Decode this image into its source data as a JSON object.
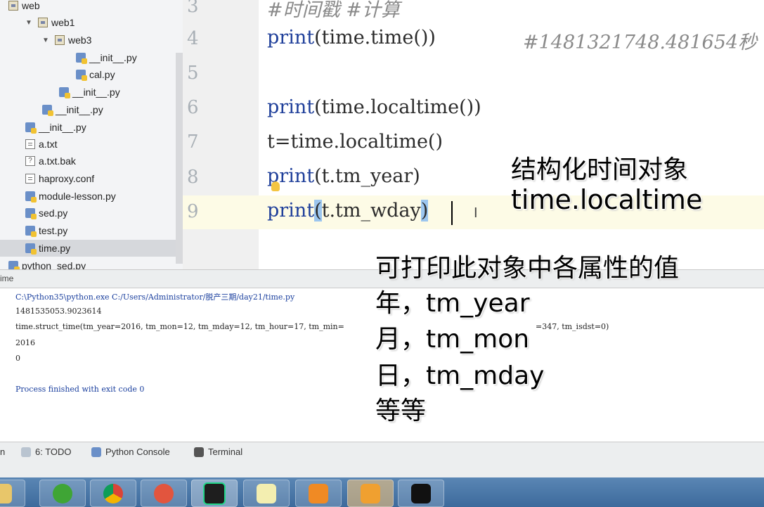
{
  "project_tree": [
    {
      "label": "web",
      "type": "folder",
      "indent": 0,
      "arrow": ""
    },
    {
      "label": "web1",
      "type": "folder",
      "indent": 1,
      "arrow": "▼"
    },
    {
      "label": "web3",
      "type": "folder",
      "indent": 2,
      "arrow": "▼"
    },
    {
      "label": "__init__.py",
      "type": "py",
      "indent": 4,
      "arrow": ""
    },
    {
      "label": "cal.py",
      "type": "py",
      "indent": 4,
      "arrow": ""
    },
    {
      "label": "__init__.py",
      "type": "py",
      "indent": 3,
      "arrow": ""
    },
    {
      "label": "__init__.py",
      "type": "py",
      "indent": 2,
      "arrow": ""
    },
    {
      "label": "__init__.py",
      "type": "py",
      "indent": 1,
      "arrow": ""
    },
    {
      "label": "a.txt",
      "type": "txt",
      "indent": 1,
      "arrow": ""
    },
    {
      "label": "a.txt.bak",
      "type": "unknown",
      "indent": 1,
      "arrow": ""
    },
    {
      "label": "haproxy.conf",
      "type": "txt",
      "indent": 1,
      "arrow": ""
    },
    {
      "label": "module-lesson.py",
      "type": "py",
      "indent": 1,
      "arrow": ""
    },
    {
      "label": "sed.py",
      "type": "py",
      "indent": 1,
      "arrow": ""
    },
    {
      "label": "test.py",
      "type": "py",
      "indent": 1,
      "arrow": ""
    },
    {
      "label": "time.py",
      "type": "py",
      "indent": 1,
      "arrow": "",
      "selected": true
    },
    {
      "label": "python_sed.py",
      "type": "py",
      "indent": 0,
      "arrow": ""
    }
  ],
  "editor": {
    "line_numbers": [
      "3",
      "4",
      "5",
      "6",
      "7",
      "8",
      "9"
    ],
    "line3_comment": "#时间戳    #计算",
    "line4_kw": "print",
    "line4_rest": "(time.time())",
    "line4_comment": "#1481321748.481654秒",
    "line6_kw": "print",
    "line6_rest": "(time.localtime())",
    "line7": "t=time.localtime()",
    "line8_kw": "print",
    "line8_rest": "(t.tm_year)",
    "line9_kw": "print",
    "line9_paren_open": "(",
    "line9_mid": "t.tm_wday",
    "line9_paren_close": ")"
  },
  "annotations": {
    "title_line1": "结构化时间对象",
    "title_line2": "time.localtime",
    "note_line1": "可打印此对象中各属性的值",
    "note_line2": "年，tm_year",
    "note_line3": "月，tm_mon",
    "note_line4": "日，tm_mday",
    "note_line5": "等等"
  },
  "run_panel": {
    "header": "ime",
    "lines": [
      "C:\\Python35\\python.exe C:/Users/Administrator/脱产三期/day21/time.py",
      "1481535053.9023614",
      "time.struct_time(tm_year=2016, tm_mon=12, tm_mday=12, tm_hour=17, tm_min=",
      "2016",
      "0",
      "",
      "Process finished with exit code 0"
    ],
    "struct_tail": "=347, tm_isdst=0)"
  },
  "tool_tabs": {
    "run_partial": "n",
    "todo": "6: TODO",
    "python_console": "Python Console",
    "terminal": "Terminal"
  },
  "taskbar_apps": [
    "explorer-icon",
    "ie-icon",
    "chrome-icon",
    "snail-icon",
    "pycharm-icon",
    "notepad-icon",
    "office-icon",
    "briefcase-icon",
    "cmd-icon"
  ],
  "colors": {
    "keyword": "#1f3f9a",
    "comment": "#8a8a8a",
    "taskbar": "#4a78a8"
  }
}
